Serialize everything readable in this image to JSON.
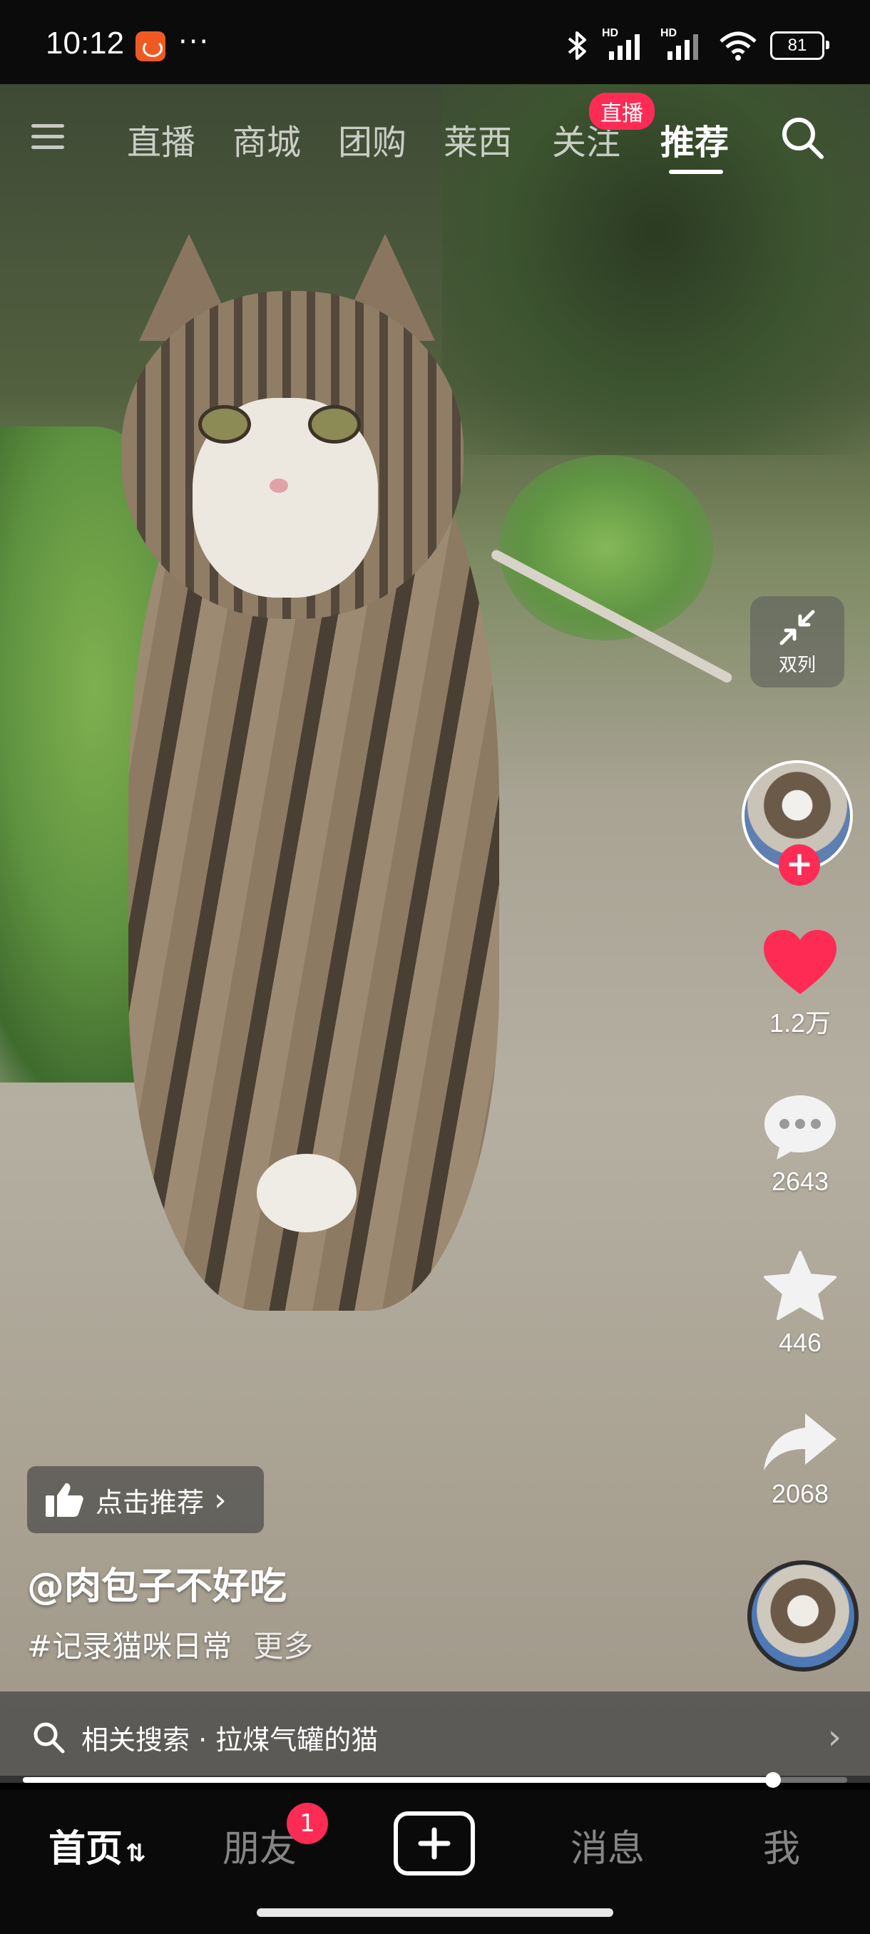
{
  "status_bar": {
    "time": "10:12",
    "more": "···",
    "network_1": "HD",
    "network_2": "HD",
    "battery": "81"
  },
  "top_tabs": {
    "items": [
      {
        "label": "直播"
      },
      {
        "label": "商城"
      },
      {
        "label": "团购"
      },
      {
        "label": "莱西"
      },
      {
        "label": "关注"
      },
      {
        "label": "推荐"
      }
    ],
    "active": "推荐",
    "live_badge": "直播"
  },
  "right_rail": {
    "dual_column_label": "双列",
    "likes": "1.2万",
    "comments": "2643",
    "favorites": "446",
    "shares": "2068"
  },
  "caption": {
    "recommend_label": "点击推荐",
    "author": "@肉包子不好吃",
    "hashtag": "#记录猫咪日常",
    "more": "更多"
  },
  "related_search": {
    "label": "相关搜索 · 拉煤气罐的猫"
  },
  "progress": {
    "fraction": 0.91
  },
  "bottom_nav": {
    "home": "首页",
    "friends": "朋友",
    "friends_badge": "1",
    "messages": "消息",
    "me": "我"
  },
  "colors": {
    "accent": "#fe2c55",
    "like": "#fe2c55"
  }
}
